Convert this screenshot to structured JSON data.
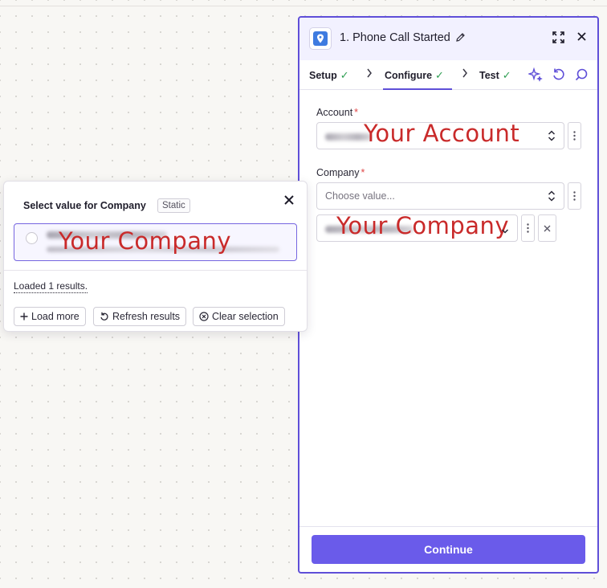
{
  "panel": {
    "title": "1. Phone Call Started",
    "tabs": [
      {
        "label": "Setup",
        "status": "complete"
      },
      {
        "label": "Configure",
        "status": "complete"
      },
      {
        "label": "Test",
        "status": "complete"
      }
    ],
    "active_tab": "Configure",
    "fields": {
      "account": {
        "label": "Account",
        "required_mark": "*",
        "overlay_text": "Your Account"
      },
      "company": {
        "label": "Company",
        "required_mark": "*",
        "placeholder": "Choose value...",
        "overlay_text": "Your Company"
      }
    },
    "continue_label": "Continue"
  },
  "popup": {
    "title": "Select value for Company",
    "badge": "Static",
    "option_overlay_text": "Your Company",
    "close_symbol": "✕",
    "loaded_text": "Loaded 1 results.",
    "buttons": {
      "load_more": "Load more",
      "refresh": "Refresh results",
      "clear": "Clear selection"
    }
  },
  "colors": {
    "accent": "#5f4fd8",
    "button": "#6a5bea",
    "check": "#2e9e52",
    "required": "#e04848",
    "overlay_text": "#c92a2a"
  }
}
